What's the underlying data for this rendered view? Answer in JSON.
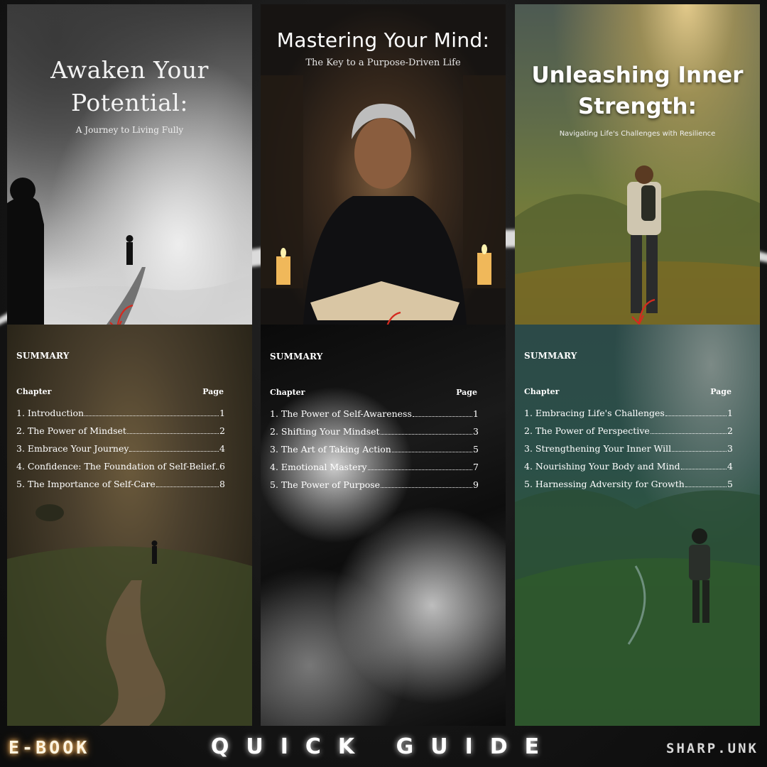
{
  "books": [
    {
      "title_line1": "Awaken Your",
      "title_line2": "Potential:",
      "subtitle": "A Journey to Living Fully",
      "summary_label": "SUMMARY",
      "chapter_header": "Chapter",
      "page_header": "Page",
      "chapters": [
        {
          "label": "1. Introduction",
          "page": "1"
        },
        {
          "label": "2. The Power of Mindset",
          "page": "2"
        },
        {
          "label": "3. Embrace Your Journey",
          "page": "4"
        },
        {
          "label": "4. Confidence: The Foundation of Self-Belief",
          "page": "6"
        },
        {
          "label": "5. The Importance of Self-Care",
          "page": "8"
        }
      ]
    },
    {
      "title_line1": "Mastering Your Mind:",
      "subtitle": "The Key to a Purpose-Driven Life",
      "summary_label": "SUMMARY",
      "chapter_header": "Chapter",
      "page_header": "Page",
      "chapters": [
        {
          "label": "1. The Power of Self-Awareness",
          "page": "1"
        },
        {
          "label": "2. Shifting Your Mindset",
          "page": "3"
        },
        {
          "label": "3. The Art of Taking Action",
          "page": "5"
        },
        {
          "label": "4. Emotional Mastery",
          "page": "7"
        },
        {
          "label": "5. The Power of Purpose",
          "page": "9"
        }
      ]
    },
    {
      "title_line1": "Unleashing Inner",
      "title_line2": "Strength:",
      "subtitle": "Navigating Life's Challenges with Resilience",
      "summary_label": "SUMMARY",
      "chapter_header": "Chapter",
      "page_header": "Page",
      "chapters": [
        {
          "label": "1. Embracing Life's Challenges",
          "page": "1"
        },
        {
          "label": "2. The Power of Perspective",
          "page": "2"
        },
        {
          "label": "3. Strengthening Your Inner Will",
          "page": "3"
        },
        {
          "label": "4. Nourishing Your Body and Mind",
          "page": "4"
        },
        {
          "label": "5. Harnessing Adversity for Growth",
          "page": "5"
        }
      ]
    }
  ],
  "footer": {
    "left": "E-BOOK",
    "center": "QUICK GUIDE",
    "right": "SHARP.UNK"
  },
  "colors": {
    "arrow": "#d42a1f",
    "ebook_glow": "#ffcf7a"
  },
  "icons": [
    "red-curved-arrow-icon"
  ]
}
